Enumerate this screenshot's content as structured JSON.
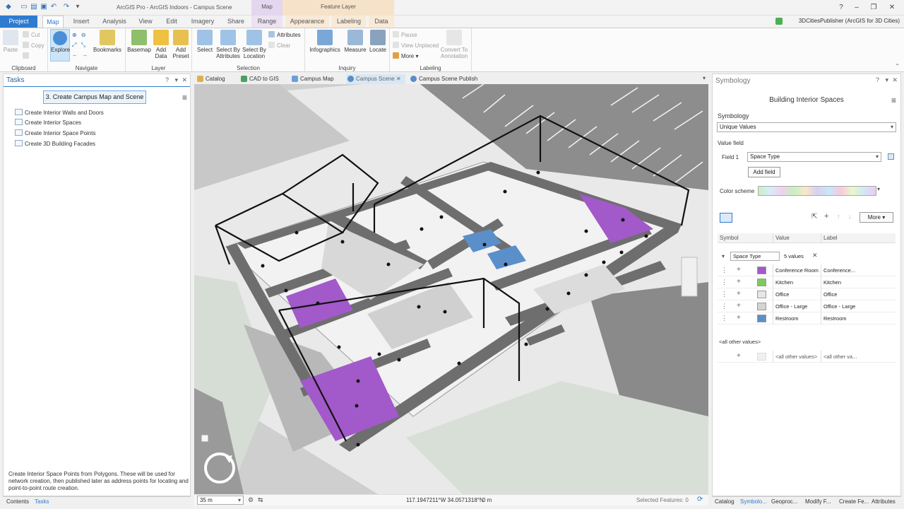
{
  "window": {
    "app_title": "ArcGIS Pro - ArcGIS Indoors - Campus Scene",
    "context_map": "Map",
    "context_feature": "Feature Layer",
    "user": "3DCitiesPublisher (ArcGIS for 3D Cities)"
  },
  "tabs": [
    "Project",
    "Map",
    "Insert",
    "Analysis",
    "View",
    "Edit",
    "Imagery",
    "Share",
    "Range",
    "Appearance",
    "Labeling",
    "Data"
  ],
  "ribbon": {
    "clipboard": {
      "paste": "Paste",
      "cut": "Cut",
      "copy": "Copy",
      "label": "Clipboard"
    },
    "navigate": {
      "explore": "Explore",
      "bookmarks": "Bookmarks",
      "label": "Navigate"
    },
    "layer": {
      "basemap": "Basemap",
      "add_data_1": "Add",
      "add_data_2": "Data",
      "add_preset_1": "Add",
      "add_preset_2": "Preset",
      "label": "Layer"
    },
    "selection": {
      "select": "Select",
      "select_by_attr_1": "Select By",
      "select_by_attr_2": "Attributes",
      "select_by_loc_1": "Select By",
      "select_by_loc_2": "Location",
      "attributes": "Attributes",
      "clear": "Clear",
      "label": "Selection"
    },
    "inquiry": {
      "infographics": "Infographics",
      "measure": "Measure",
      "locate": "Locate",
      "label": "Inquiry"
    },
    "labeling": {
      "pause": "Pause",
      "view_unplaced": "View Unplaced",
      "more": "More",
      "convert_1": "Convert To",
      "convert_2": "Annotation",
      "label": "Labeling"
    }
  },
  "tasks": {
    "title": "Tasks",
    "current_task": "3. Create Campus Map and Scene",
    "items": [
      "Create Interior Walls and Doors",
      "Create Interior Spaces",
      "Create Interior Space Points",
      "Create 3D Building Facades"
    ],
    "description": "Create Interior Space Points from Polygons. These will be used for network creation, then published later as address points for locating and point-to-point route creation.",
    "bottom_tabs": [
      "Contents",
      "Tasks"
    ]
  },
  "doc_tabs": [
    "Catalog",
    "CAD to GIS",
    "Campus Map",
    "Campus Scene",
    "Campus Scene Publish"
  ],
  "map": {
    "scale": "35 m",
    "coordinates": "117.1947211°W 34.0571318°N",
    "elevation": "0 m",
    "selected_features": "Selected Features: 0"
  },
  "symbology": {
    "pane_title": "Symbology",
    "layer_name": "Building Interior Spaces",
    "section": "Symbology",
    "renderer": "Unique Values",
    "value_field_label": "Value field",
    "field1_label": "Field 1",
    "field1_value": "Space Type",
    "add_field": "Add field",
    "color_scheme_label": "Color scheme",
    "more": "More",
    "headers": [
      "Symbol",
      "Value",
      "Label"
    ],
    "group_field": "Space Type",
    "group_count": "5 values",
    "rows": [
      {
        "value": "Conference Room",
        "label": "Conference...",
        "color": "#a259c9"
      },
      {
        "value": "Kitchen",
        "label": "Kitchen",
        "color": "#7dcb5a"
      },
      {
        "value": "Office",
        "label": "Office",
        "color": "#e6e6e6"
      },
      {
        "value": "Office - Large",
        "label": "Office - Large",
        "color": "#d4d4d4"
      },
      {
        "value": "Restroom",
        "label": "Restroom",
        "color": "#5b8fca"
      }
    ],
    "all_other_heading": "<all other values>",
    "all_other_value": "<all other values>",
    "all_other_label": "<all other va..."
  },
  "bottom_tabs_right": [
    "Catalog",
    "Symbolo...",
    "Geoproc...",
    "Modify F...",
    "Create Fe...",
    "Attributes"
  ],
  "colors": {
    "accent": "#2e7bcf",
    "conference": "#a259c9",
    "restroom": "#5b8fca",
    "wall": "#6e6e6e"
  }
}
